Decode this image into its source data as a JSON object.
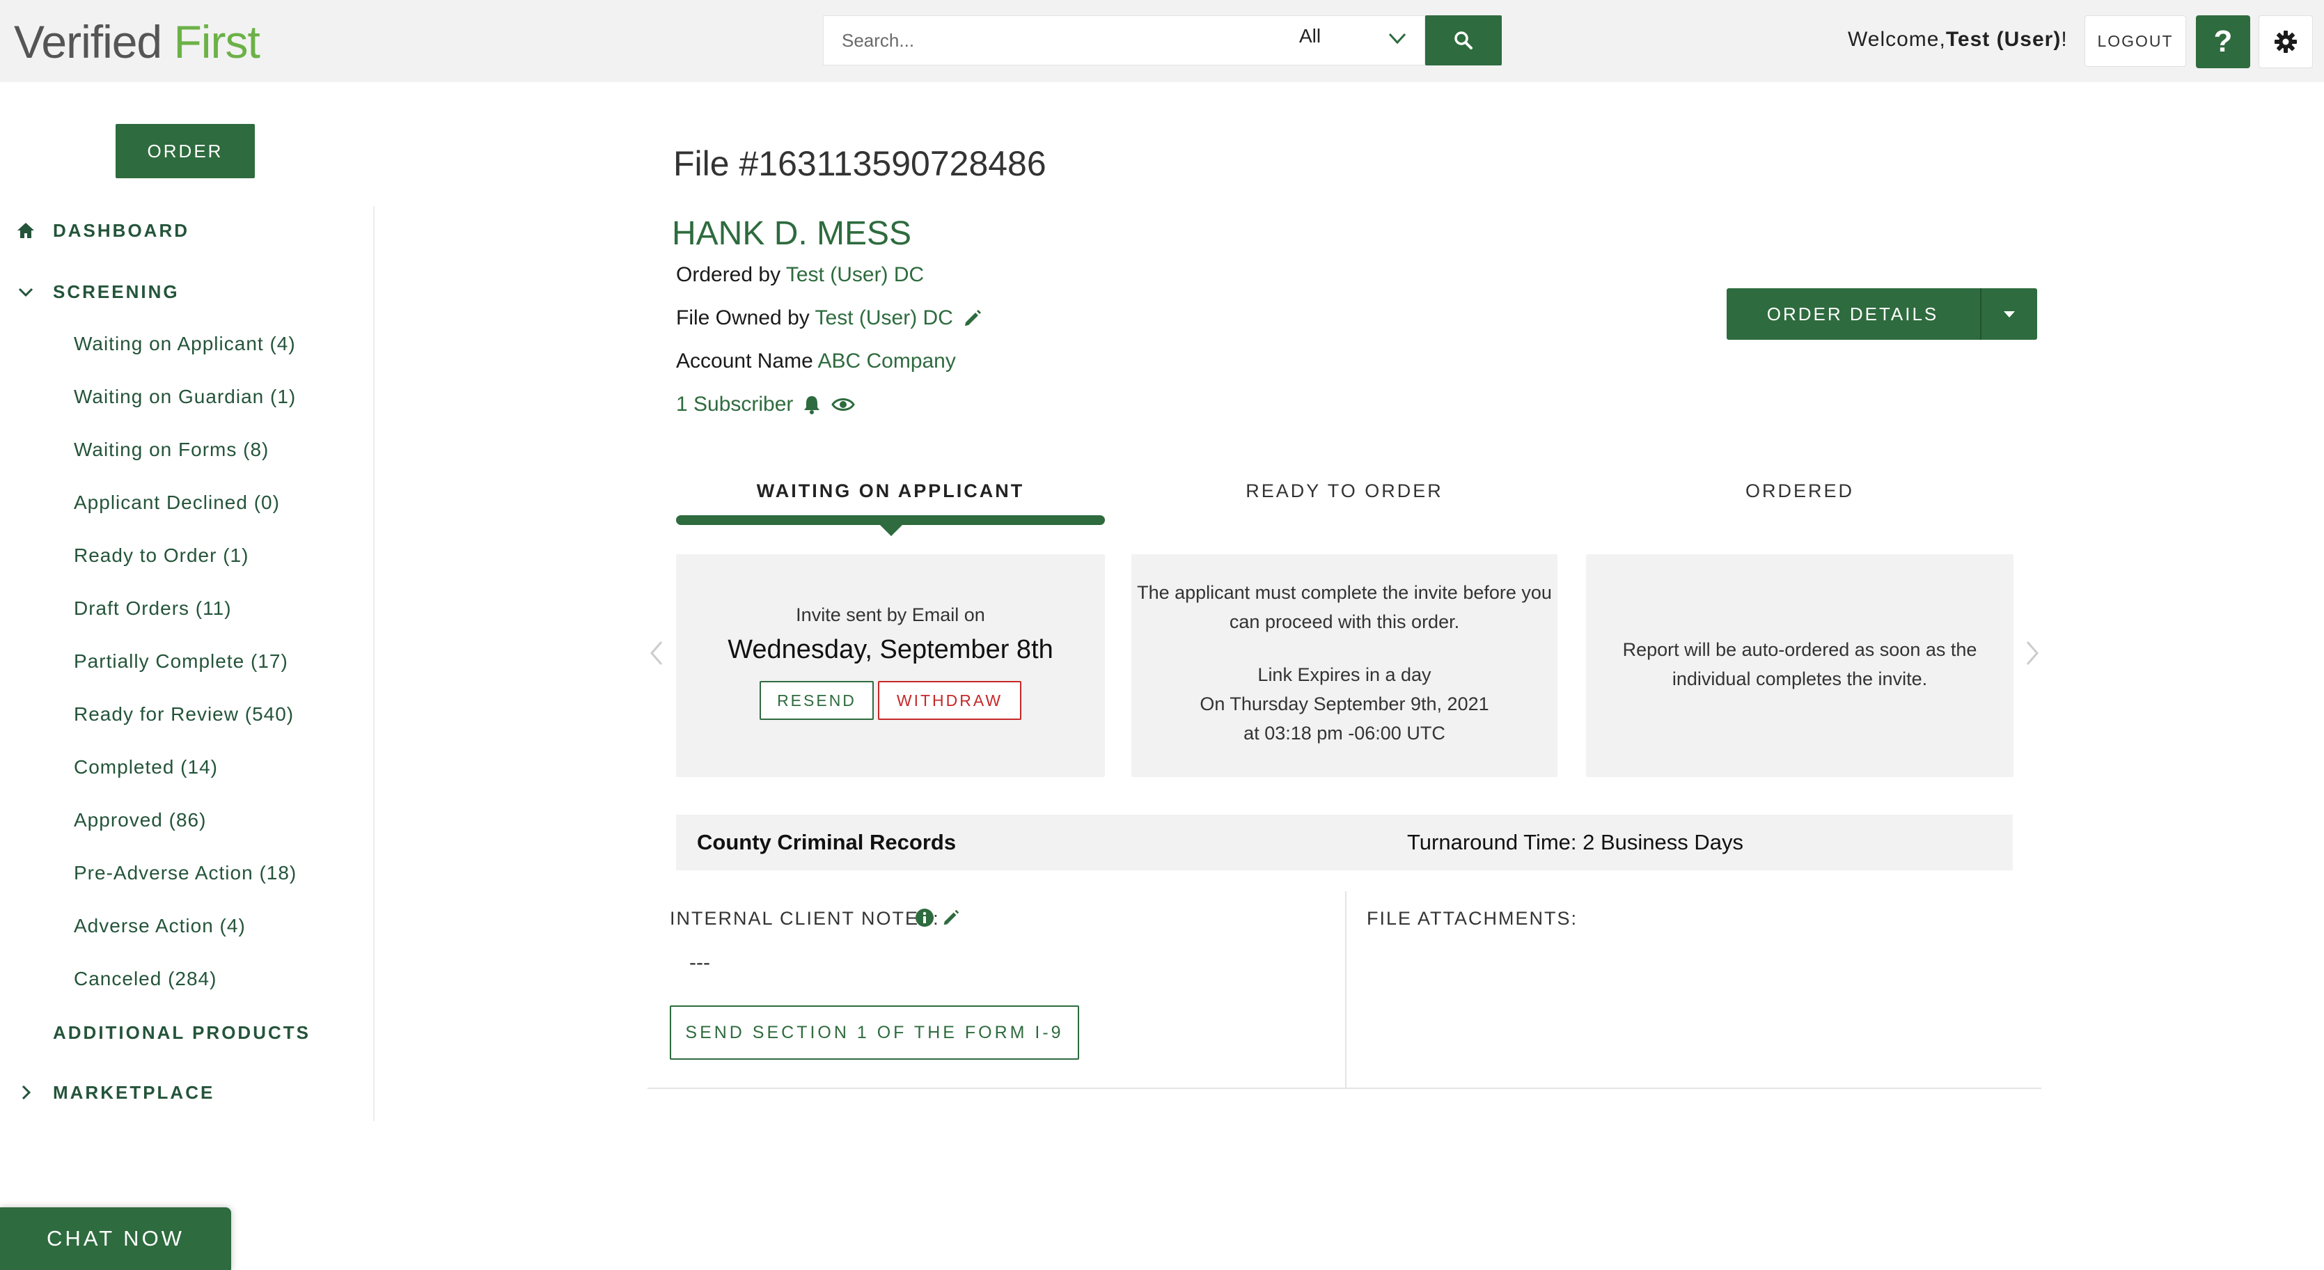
{
  "header": {
    "logo_part1": "Verified",
    "logo_part2": "First",
    "search_placeholder": "Search...",
    "search_scope": "All",
    "welcome_prefix": "Welcome,",
    "welcome_user": "Test (User)",
    "welcome_suffix": "!",
    "logout_label": "LOGOUT",
    "help_label": "?"
  },
  "sidebar": {
    "order_label": "ORDER",
    "dashboard_label": "DASHBOARD",
    "screening_label": "SCREENING",
    "screening_items": [
      "Waiting on Applicant (4)",
      "Waiting on Guardian (1)",
      "Waiting on Forms (8)",
      "Applicant Declined (0)",
      "Ready to Order (1)",
      "Draft Orders (11)",
      "Partially Complete (17)",
      "Ready for Review (540)",
      "Completed (14)",
      "Approved (86)",
      "Pre-Adverse Action (18)",
      "Adverse Action (4)",
      "Canceled (284)"
    ],
    "additional_products_label": "ADDITIONAL PRODUCTS",
    "marketplace_label": "MARKETPLACE"
  },
  "file": {
    "title": "File #163113590728486",
    "name": "HANK D. MESS",
    "ordered_by_label": "Ordered by",
    "ordered_by_value": "Test (User) DC",
    "owned_by_label": "File Owned by",
    "owned_by_value": "Test (User) DC",
    "account_label": "Account Name",
    "account_value": "ABC Company",
    "subscribers": "1 Subscriber",
    "order_details_label": "ORDER DETAILS"
  },
  "steps": [
    {
      "label": "WAITING ON APPLICANT",
      "active": true
    },
    {
      "label": "READY TO ORDER",
      "active": false
    },
    {
      "label": "ORDERED",
      "active": false
    }
  ],
  "cards": {
    "invite_line": "Invite sent by Email on",
    "invite_date": "Wednesday, September 8th",
    "resend_label": "RESEND",
    "withdraw_label": "WITHDRAW",
    "ready_line1": "The applicant must complete the invite before you",
    "ready_line2": "can proceed with this order.",
    "expires_line1": "Link Expires in a day",
    "expires_line2": "On Thursday September 9th, 2021",
    "expires_line3": "at 03:18 pm -06:00 UTC",
    "ordered_line1": "Report will be auto-ordered as soon as the",
    "ordered_line2": "individual completes the invite."
  },
  "service": {
    "name": "County Criminal Records",
    "turnaround": "Turnaround Time: 2 Business Days"
  },
  "notes": {
    "label": "INTERNAL CLIENT NOTES:",
    "value": "---",
    "i9_label": "SEND SECTION 1 OF THE FORM I-9",
    "attachments_label": "FILE ATTACHMENTS:"
  },
  "chat": {
    "label": "CHAT NOW"
  },
  "colors": {
    "brand_green": "#2e6b3e",
    "logo_green": "#6cb147",
    "danger_red": "#c62828",
    "panel_gray": "#f2f2f2"
  },
  "icons": {
    "search": "search-icon",
    "settings": "gear-icon",
    "dashboard": "home-icon",
    "screening_toggle": "chevron-down-icon",
    "marketplace_toggle": "chevron-right-icon",
    "edit": "pencil-icon",
    "notify": "bell-icon",
    "watch": "eye-icon",
    "info": "info-icon",
    "carousel_prev": "chevron-left-icon",
    "carousel_next": "chevron-right-icon"
  }
}
